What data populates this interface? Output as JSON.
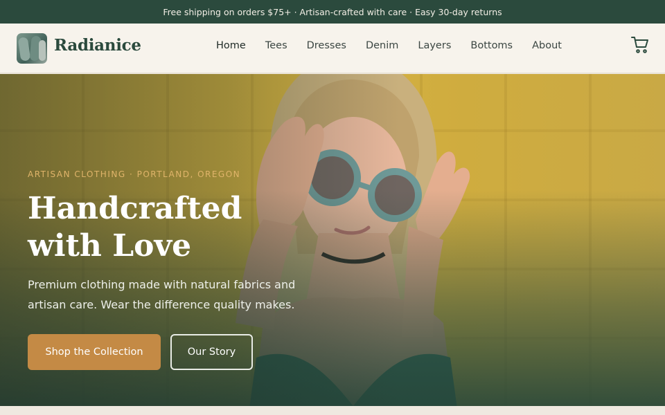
{
  "announcement": "Free shipping on orders $75+ · Artisan-crafted with care · Easy 30-day returns",
  "header": {
    "brand": "Radianice",
    "nav": [
      "Home",
      "Tees",
      "Dresses",
      "Denim",
      "Layers",
      "Bottoms",
      "About"
    ],
    "active_nav": "Home",
    "cart_icon": "shopping-cart-icon"
  },
  "hero": {
    "eyebrow": "ARTISAN CLOTHING · PORTLAND, OREGON",
    "headline_line1": "Handcrafted",
    "headline_line2": "with Love",
    "subhead_line1": "Premium clothing made with natural fabrics and",
    "subhead_line2": "artisan care. Wear the difference quality makes.",
    "primary_cta": "Shop the Collection",
    "secondary_cta": "Our Story"
  },
  "colors": {
    "brand_green": "#2b4a3d",
    "accent_caramel": "#c48a45",
    "header_bg": "#f7f3ec",
    "hero_wall": "#d6b03f"
  }
}
